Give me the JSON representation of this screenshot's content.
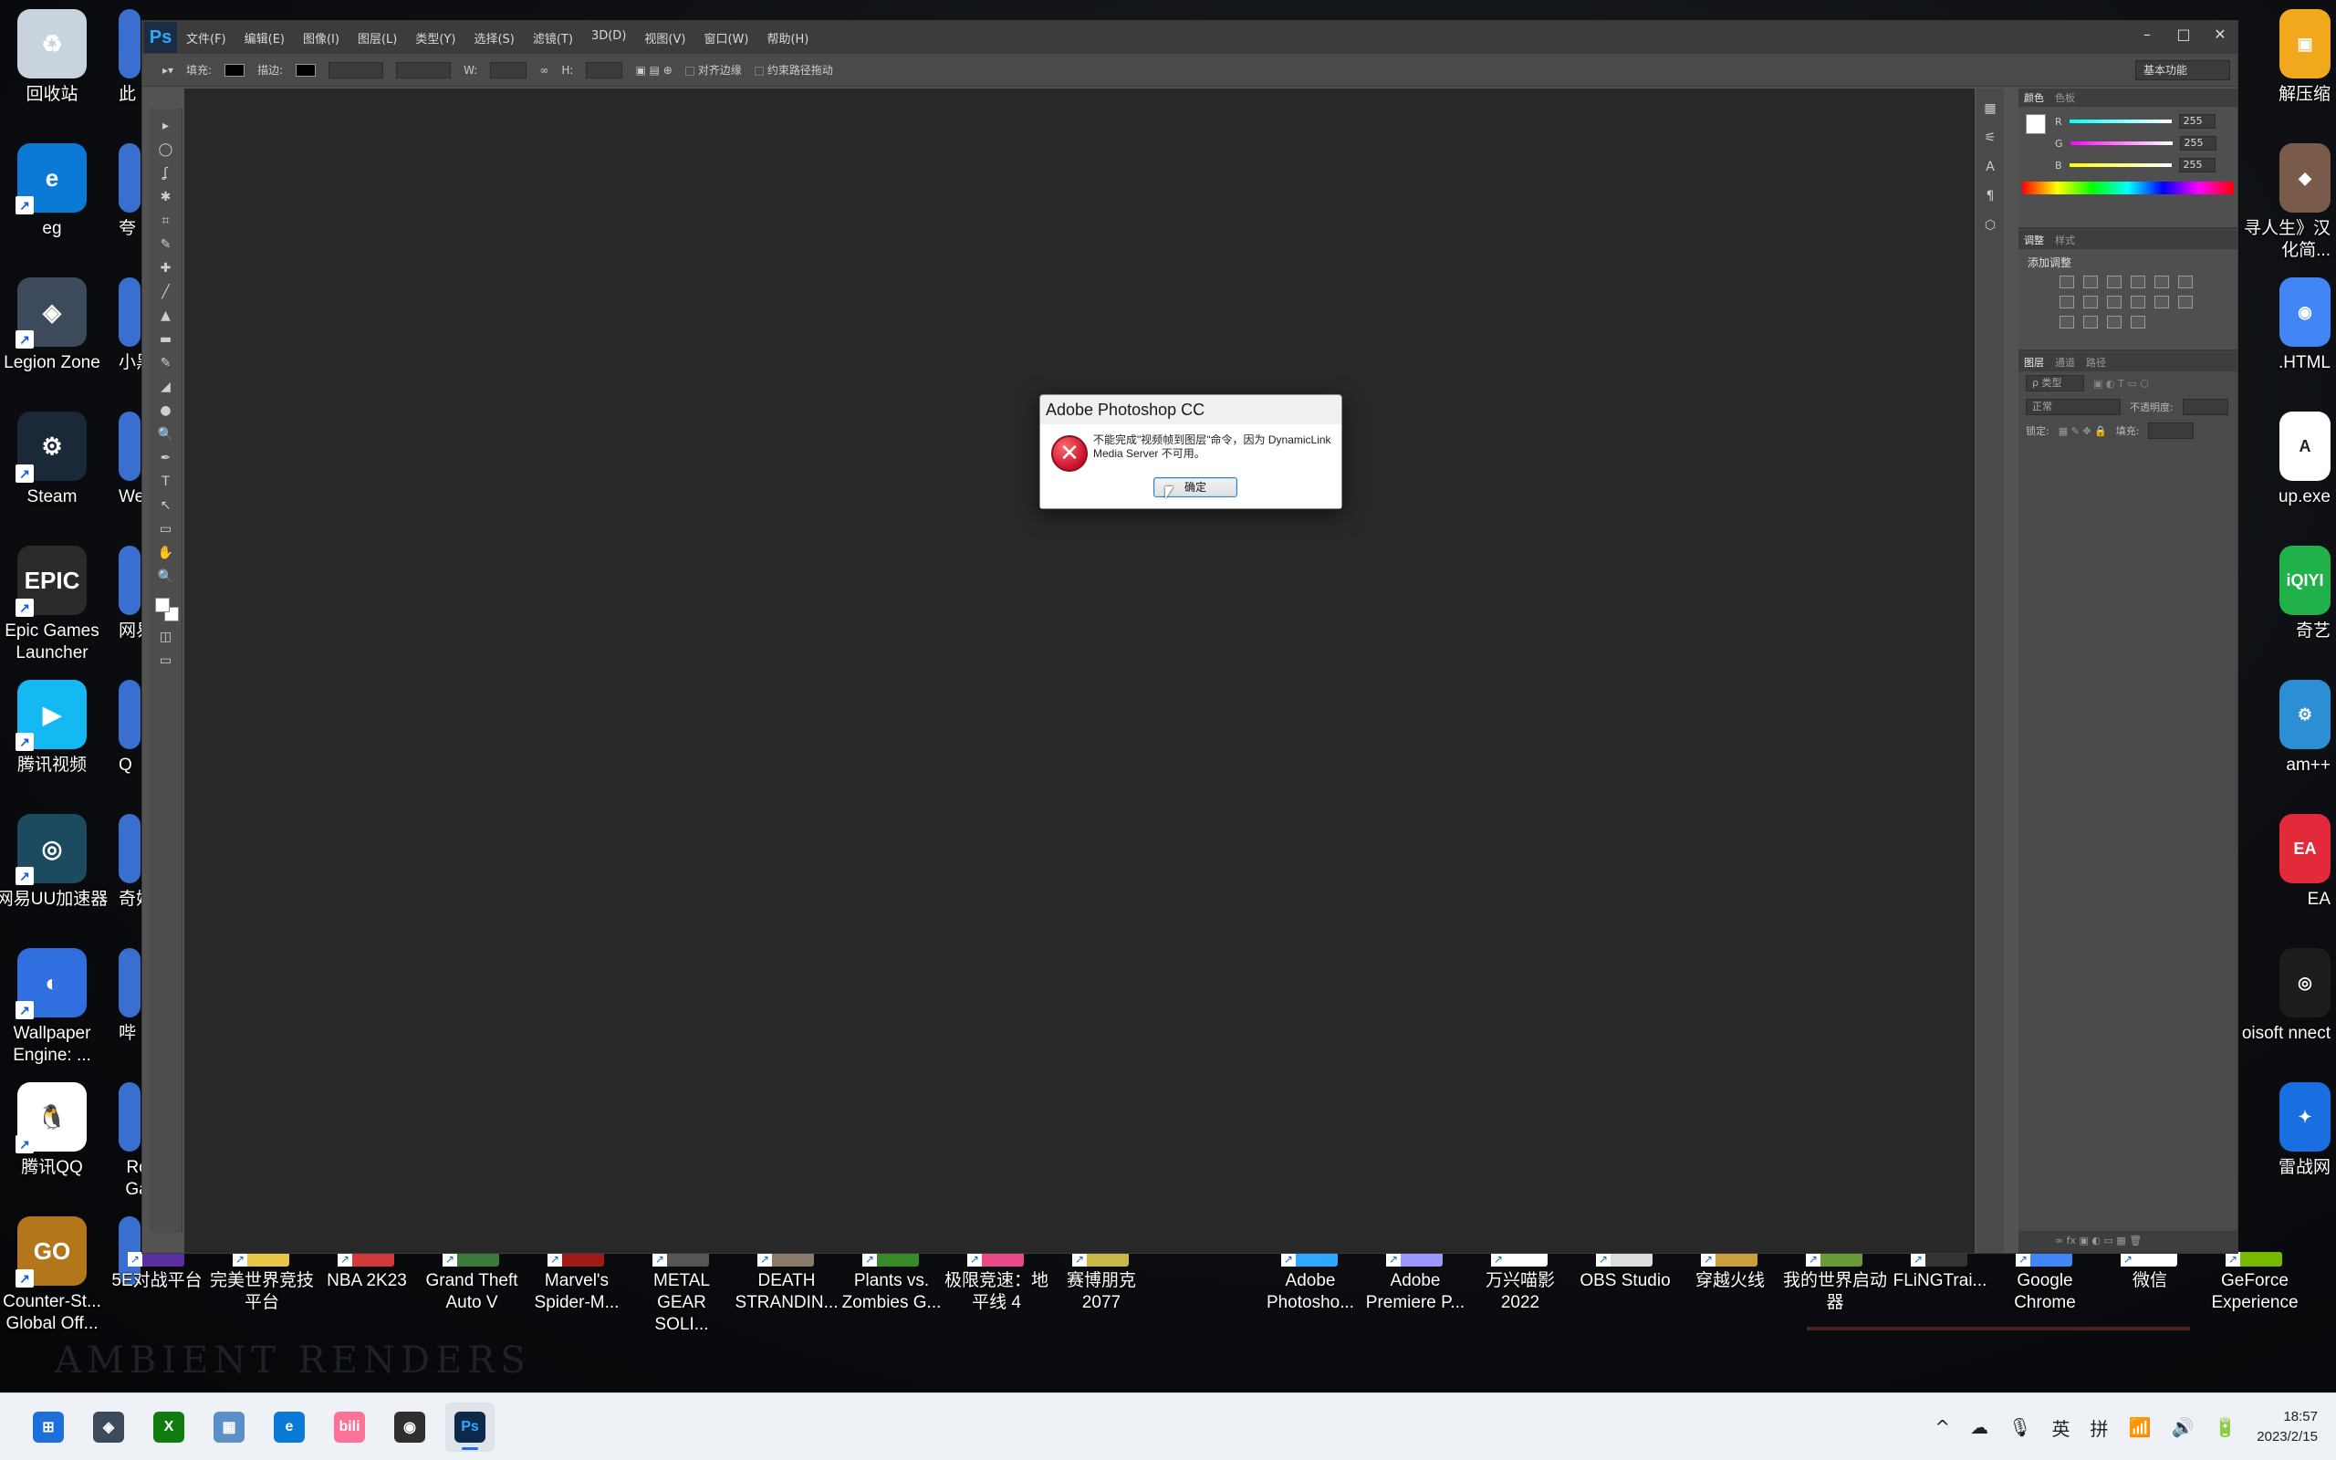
{
  "desktop": {
    "left_icons": [
      {
        "label": "回收站",
        "color": "#c9d3dd",
        "glyph": "♻"
      },
      {
        "label": "eg",
        "color": "#0a7ad6",
        "glyph": "e"
      },
      {
        "label": "Legion Zone",
        "color": "#3d4a5c",
        "glyph": "◈"
      },
      {
        "label": "Steam",
        "color": "#1b2838",
        "glyph": "⚙"
      },
      {
        "label": "Epic Games Launcher",
        "color": "#2a2a2a",
        "glyph": "EPIC"
      },
      {
        "label": "腾讯视频",
        "color": "#14b8f2",
        "glyph": "▶"
      },
      {
        "label": "网易UU加速器",
        "color": "#1c4a5e",
        "glyph": "◎"
      },
      {
        "label": "Wallpaper Engine: ...",
        "color": "#2f6fe0",
        "glyph": "◐"
      },
      {
        "label": "腾讯QQ",
        "color": "#ffffff",
        "glyph": "🐧"
      },
      {
        "label": "Counter-St... Global Off...",
        "color": "#b3761a",
        "glyph": "GO"
      }
    ],
    "left_col2_labels": [
      "此",
      "夸",
      "小黑",
      "We",
      "网易",
      "Q",
      "奇妙",
      "哔",
      "Rc Ga",
      ""
    ],
    "right_icons": [
      {
        "label": "解压缩",
        "color": "#f2a81d",
        "glyph": "▣"
      },
      {
        "label": "寻人生》汉化简...",
        "color": "#7a5a4a",
        "glyph": "◆"
      },
      {
        "label": ".HTML",
        "color": "#4285f4",
        "glyph": "◉"
      },
      {
        "label": "up.exe",
        "color": "#ffffff",
        "glyph": "A"
      },
      {
        "label": "奇艺",
        "color": "#21b14b",
        "glyph": "iQIYI"
      },
      {
        "label": "am++",
        "color": "#2c8fd4",
        "glyph": "⚙"
      },
      {
        "label": "EA",
        "color": "#e22a3a",
        "glyph": "EA"
      },
      {
        "label": "oisoft nnect",
        "color": "#1c1c1c",
        "glyph": "◎"
      },
      {
        "label": "雷战网",
        "color": "#1a6fe0",
        "glyph": "✦"
      }
    ],
    "bottom_icons": [
      {
        "label": "5E对战平台",
        "color": "#5a2fa0"
      },
      {
        "label": "完美世界竞技平台",
        "color": "#e8c64a"
      },
      {
        "label": "NBA 2K23",
        "color": "#d03a3a"
      },
      {
        "label": "Grand Theft Auto V",
        "color": "#3a7a3a"
      },
      {
        "label": "Marvel's Spider-M...",
        "color": "#a01a1a"
      },
      {
        "label": "METAL GEAR SOLI...",
        "color": "#555555"
      },
      {
        "label": "DEATH STRANDIN...",
        "color": "#8a7a6a"
      },
      {
        "label": "Plants vs. Zombies G...",
        "color": "#3a8a2a"
      },
      {
        "label": "极限竞速：地平线 4",
        "color": "#e84a8a"
      },
      {
        "label": "赛博朋克 2077",
        "color": "#c8b84a"
      },
      {
        "label": "Adobe Photosho...",
        "color": "#31a8ff"
      },
      {
        "label": "Adobe Premiere P...",
        "color": "#9999ff"
      },
      {
        "label": "万兴喵影 2022",
        "color": "#ffffff"
      },
      {
        "label": "OBS Studio",
        "color": "#dddddd"
      },
      {
        "label": "穿越火线",
        "color": "#c8a040"
      },
      {
        "label": "我的世界启动器",
        "color": "#6a9a3a"
      },
      {
        "label": "FLiNGTrai...",
        "color": "#333333"
      },
      {
        "label": "Google Chrome",
        "color": "#4285f4"
      },
      {
        "label": "微信",
        "color": "#ffffff"
      },
      {
        "label": "GeForce Experience",
        "color": "#76b900"
      }
    ],
    "watermark": "AMBIENT RENDERS"
  },
  "photoshop": {
    "logo": "Ps",
    "menu": [
      "文件(F)",
      "编辑(E)",
      "图像(I)",
      "图层(L)",
      "类型(Y)",
      "选择(S)",
      "滤镜(T)",
      "3D(D)",
      "视图(V)",
      "窗口(W)",
      "帮助(H)"
    ],
    "window_buttons": {
      "minimize": "–",
      "restore": "□",
      "close": "✕"
    },
    "options": {
      "fill_label": "填充:",
      "stroke_label": "描边:",
      "w_label": "W:",
      "h_label": "H:",
      "align_edges": "对齐边缘",
      "constrain_path": "约束路径拖动",
      "workspace": "基本功能"
    },
    "tools": [
      "▸",
      "◯",
      "ʆ",
      "✱",
      "⌗",
      "✎",
      "✚",
      "╱",
      "▲",
      "▬",
      "✎",
      "◢",
      "●",
      "🔍",
      "✒",
      "T",
      "↖",
      "▭",
      "✋",
      "🔍"
    ],
    "dock_icons": [
      "▦",
      "⚟",
      "A",
      "¶",
      "⬡"
    ],
    "color_panel": {
      "tabs": [
        "颜色",
        "色板"
      ],
      "r_label": "R",
      "g_label": "G",
      "b_label": "B",
      "r": "255",
      "g": "255",
      "b": "255"
    },
    "adjust_panel": {
      "tabs": [
        "调整",
        "样式"
      ],
      "heading": "添加调整"
    },
    "layers_panel": {
      "tabs": [
        "图层",
        "通道",
        "路径"
      ],
      "filter": "ρ 类型",
      "blend_mode": "正常",
      "opacity_label": "不透明度:",
      "lock_label": "锁定:",
      "fill_label": "填充:"
    }
  },
  "dialog": {
    "title": "Adobe Photoshop CC",
    "message": "不能完成\"视频帧到图层\"命令，因为 DynamicLink Media Server 不可用。",
    "ok_label": "确定",
    "error_glyph": "✕"
  },
  "taskbar": {
    "apps": [
      {
        "name": "start",
        "glyph": "⊞",
        "color": "#1e6fd9"
      },
      {
        "name": "legion",
        "glyph": "◈",
        "color": "#3d4a5c"
      },
      {
        "name": "xbox",
        "glyph": "X",
        "color": "#107c10"
      },
      {
        "name": "lenovo-vantage",
        "glyph": "▦",
        "color": "#5a8fc8"
      },
      {
        "name": "edge",
        "glyph": "e",
        "color": "#0a7ad6"
      },
      {
        "name": "bilibili",
        "glyph": "bili",
        "color": "#fb7299"
      },
      {
        "name": "obs",
        "glyph": "◉",
        "color": "#302e31"
      },
      {
        "name": "photoshop",
        "glyph": "Ps",
        "color": "#0d2a4a"
      }
    ],
    "tray": {
      "chevron": "^",
      "cloud": "☁",
      "mic": "🎙",
      "ime1": "英",
      "ime2": "拼",
      "wifi": "📶",
      "volume": "🔊",
      "battery": "🔋"
    },
    "time": "18:57",
    "date": "2023/2/15"
  }
}
